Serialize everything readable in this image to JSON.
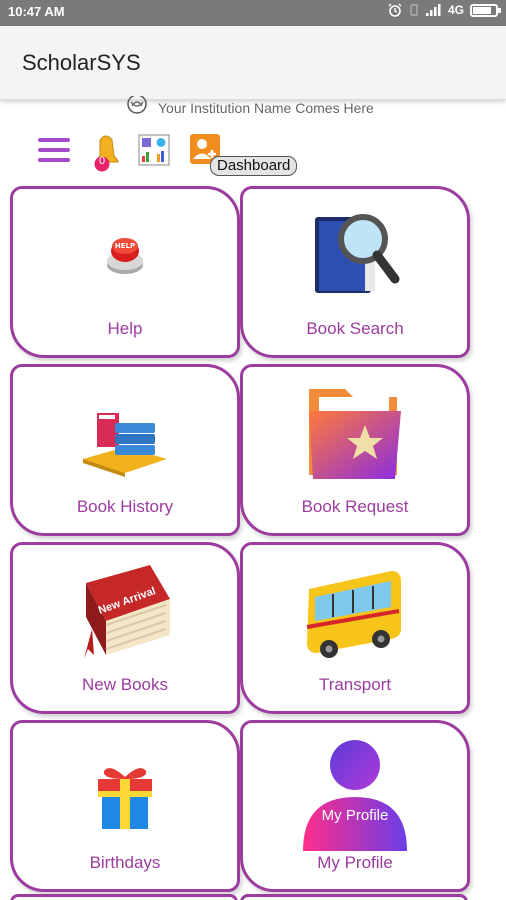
{
  "status_bar": {
    "time": "10:47 AM",
    "network": "4G",
    "battery_level": 0.9
  },
  "app_bar": {
    "title": "ScholarSYS"
  },
  "institution": {
    "name": "Your Institution Name Comes Here"
  },
  "toolbar": {
    "notification_count": "0",
    "tooltip": "Dashboard"
  },
  "tiles": [
    {
      "label": "Help",
      "icon": "help-button-icon"
    },
    {
      "label": "Book Search",
      "icon": "book-search-icon"
    },
    {
      "label": "Book History",
      "icon": "book-stack-icon"
    },
    {
      "label": "Book Request",
      "icon": "folder-star-icon"
    },
    {
      "label": "New Books",
      "icon": "new-arrival-book-icon",
      "badge": "New Arrival"
    },
    {
      "label": "Transport",
      "icon": "bus-icon"
    },
    {
      "label": "Birthdays",
      "icon": "gift-icon"
    },
    {
      "label": "My Profile",
      "icon": "profile-icon",
      "badge": "My Profile"
    }
  ],
  "colors": {
    "accent": "#9c3c9e",
    "status_bar": "#7a7a7a",
    "app_bar": "#f4f4f4"
  }
}
